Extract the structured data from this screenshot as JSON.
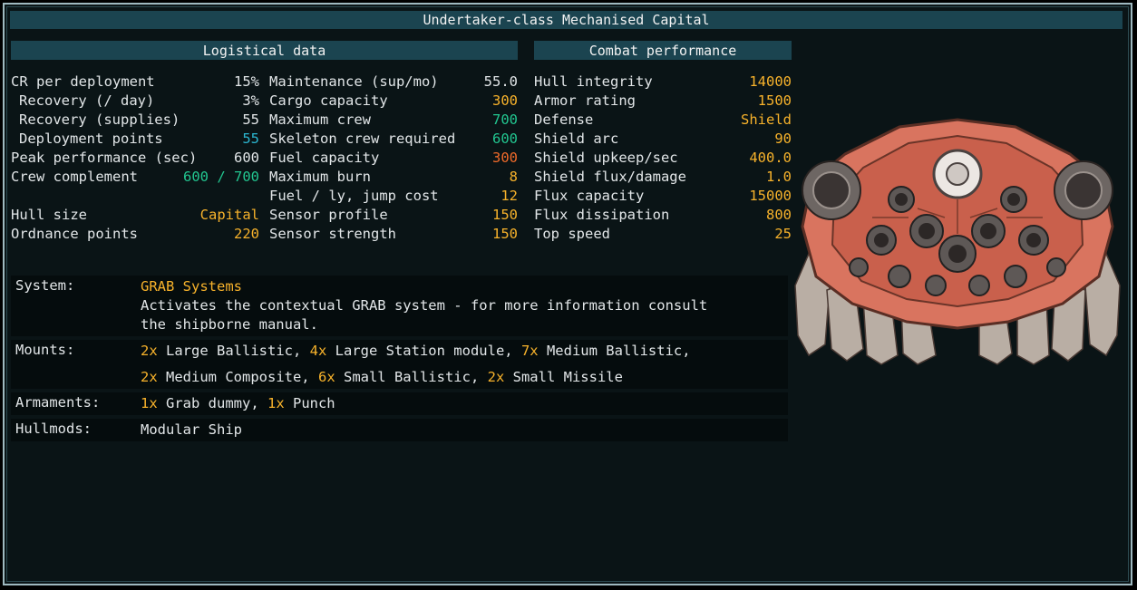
{
  "title": "Undertaker-class Mechanised Capital",
  "logistical": {
    "header": "Logistical data",
    "col1": [
      {
        "label": "CR per deployment",
        "value": "15%",
        "color": "white",
        "indent": false
      },
      {
        "label": "Recovery (/ day)",
        "value": "3%",
        "color": "white",
        "indent": true
      },
      {
        "label": "Recovery (supplies)",
        "value": "55",
        "color": "white",
        "indent": true
      },
      {
        "label": "Deployment points",
        "value": "55",
        "color": "cyan",
        "indent": true
      },
      {
        "label": "Peak performance (sec)",
        "value": "600",
        "color": "white",
        "indent": false
      },
      {
        "label": "Crew complement",
        "value": "600 / 700",
        "color": "green",
        "indent": false
      },
      {
        "label": "",
        "value": "",
        "color": "white",
        "indent": false
      },
      {
        "label": "Hull size",
        "value": "Capital",
        "color": "orange",
        "indent": false
      },
      {
        "label": "Ordnance points",
        "value": "220",
        "color": "orange",
        "indent": false
      }
    ],
    "col2": [
      {
        "label": "Maintenance (sup/mo)",
        "value": "55.0",
        "color": "white"
      },
      {
        "label": "Cargo capacity",
        "value": "300",
        "color": "orange"
      },
      {
        "label": "Maximum crew",
        "value": "700",
        "color": "green"
      },
      {
        "label": "Skeleton crew required",
        "value": "600",
        "color": "green"
      },
      {
        "label": "Fuel capacity",
        "value": "300",
        "color": "red"
      },
      {
        "label": "Maximum burn",
        "value": "8",
        "color": "orange"
      },
      {
        "label": "Fuel / ly, jump cost",
        "value": "12",
        "color": "orange"
      },
      {
        "label": "Sensor profile",
        "value": "150",
        "color": "orange"
      },
      {
        "label": "Sensor strength",
        "value": "150",
        "color": "orange"
      }
    ]
  },
  "combat": {
    "header": "Combat performance",
    "rows": [
      {
        "label": "Hull integrity",
        "value": "14000",
        "color": "orange"
      },
      {
        "label": "Armor rating",
        "value": "1500",
        "color": "orange"
      },
      {
        "label": "Defense",
        "value": "Shield",
        "color": "orange"
      },
      {
        "label": "Shield arc",
        "value": "90",
        "color": "orange"
      },
      {
        "label": "Shield upkeep/sec",
        "value": "400.0",
        "color": "orange"
      },
      {
        "label": "Shield flux/damage",
        "value": "1.0",
        "color": "orange"
      },
      {
        "label": "Flux capacity",
        "value": "15000",
        "color": "orange"
      },
      {
        "label": "Flux dissipation",
        "value": "800",
        "color": "orange"
      },
      {
        "label": "Top speed",
        "value": "25",
        "color": "orange"
      }
    ]
  },
  "info": {
    "system_label": "System:",
    "system_name": "GRAB Systems",
    "system_desc": "Activates the contextual GRAB system - for more information consult the shipborne manual.",
    "mounts_label": "Mounts:",
    "mounts": [
      [
        {
          "count": "2x",
          "text": "Large Ballistic, "
        },
        {
          "count": "4x",
          "text": "Large Station module, "
        },
        {
          "count": "7x",
          "text": "Medium Ballistic,"
        }
      ],
      [
        {
          "count": "2x",
          "text": "Medium Composite, "
        },
        {
          "count": "6x",
          "text": "Small Ballistic, "
        },
        {
          "count": "2x",
          "text": "Small Missile"
        }
      ]
    ],
    "armaments_label": "Armaments:",
    "armaments": [
      {
        "count": "1x",
        "text": "Grab dummy, "
      },
      {
        "count": "1x",
        "text": "Punch"
      }
    ],
    "hullmods_label": "Hullmods:",
    "hullmods": "Modular Ship"
  },
  "colors": {
    "white": "#e2e6e8",
    "orange": "#f7b22b",
    "cyan": "#2bb5cf",
    "green": "#22c690",
    "red": "#f06a2a",
    "header_bg": "#1b4450",
    "panel_bg": "#0a1416"
  }
}
